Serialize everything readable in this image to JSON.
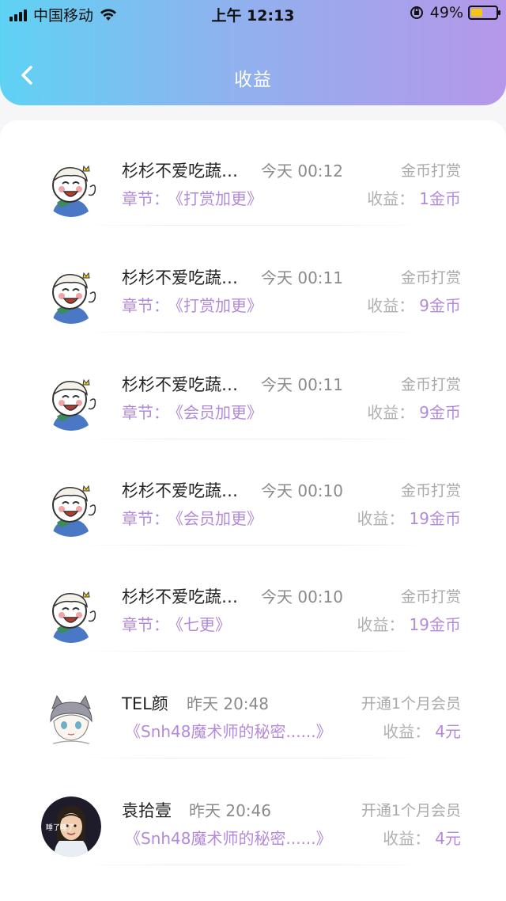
{
  "status_bar": {
    "carrier": "中国移动",
    "time": "上午 12:13",
    "battery": "49%"
  },
  "nav": {
    "title": "收益"
  },
  "labels": {
    "chapter_prefix": "章节：",
    "earning_prefix": "收益："
  },
  "records": [
    {
      "name": "杉杉不爱吃蔬…",
      "time": "今天 00:12",
      "type": "金币打赏",
      "chapter": "《打赏加更》",
      "amount": "1金币",
      "avatar": "cartoon-boy"
    },
    {
      "name": "杉杉不爱吃蔬…",
      "time": "今天 00:11",
      "type": "金币打赏",
      "chapter": "《打赏加更》",
      "amount": "9金币",
      "avatar": "cartoon-boy"
    },
    {
      "name": "杉杉不爱吃蔬…",
      "time": "今天 00:11",
      "type": "金币打赏",
      "chapter": "《会员加更》",
      "amount": "9金币",
      "avatar": "cartoon-boy"
    },
    {
      "name": "杉杉不爱吃蔬…",
      "time": "今天 00:10",
      "type": "金币打赏",
      "chapter": "《会员加更》",
      "amount": "19金币",
      "avatar": "cartoon-boy"
    },
    {
      "name": "杉杉不爱吃蔬…",
      "time": "今天 00:10",
      "type": "金币打赏",
      "chapter": "《七更》",
      "amount": "19金币",
      "avatar": "cartoon-boy"
    },
    {
      "name": "TEL颜",
      "time": "昨天 20:48",
      "type": "开通1个月会员",
      "chapter": "《Snh48魔术师的秘密......》",
      "amount": "4元",
      "avatar": "anime-cat-boy"
    },
    {
      "name": "袁拾壹",
      "time": "昨天 20:46",
      "type": "开通1个月会员",
      "chapter": "《Snh48魔术师的秘密......》",
      "amount": "4元",
      "avatar": "photo-girl",
      "avatar_caption": "睡了睡了"
    }
  ]
}
